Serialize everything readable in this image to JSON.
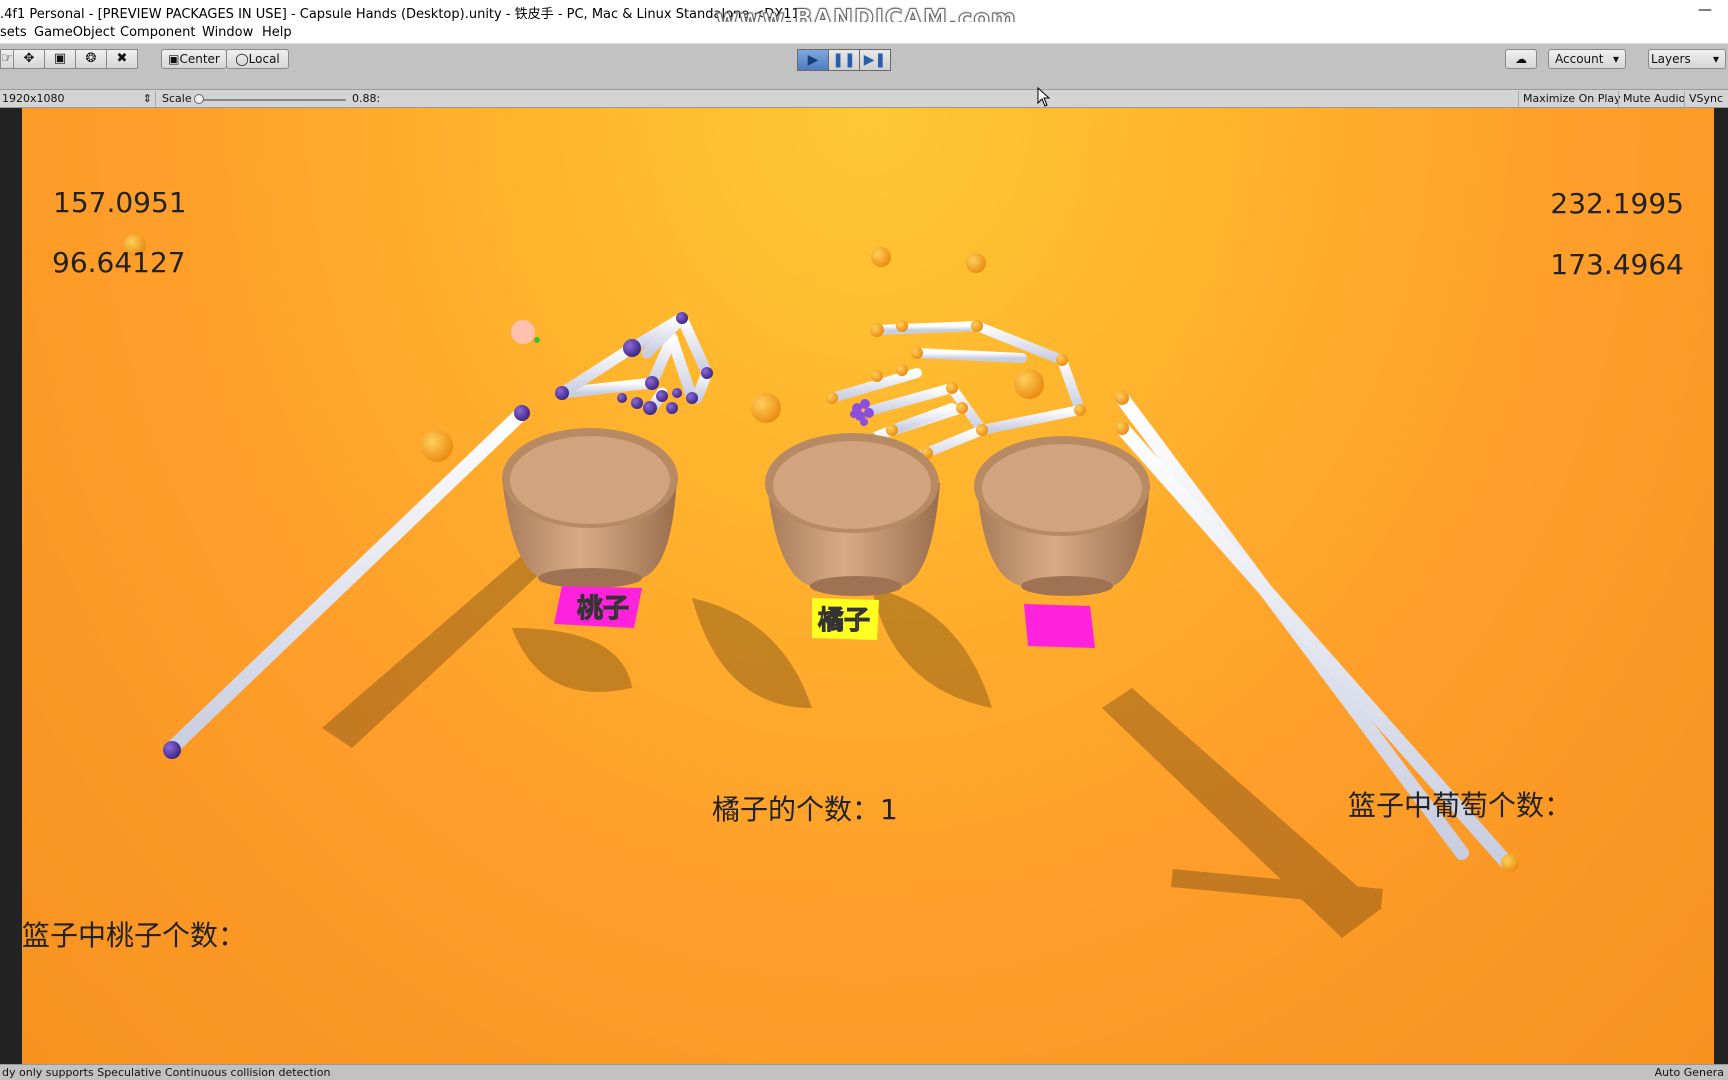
{
  "window": {
    "title": ".4f1 Personal - [PREVIEW PACKAGES IN USE] - Capsule Hands (Desktop).unity - 铁皮手 - PC, Mac & Linux Standalone <DX11>",
    "watermark": "www.BANDICAM.com",
    "minimize_glyph": "—"
  },
  "menu": {
    "items": [
      "sets",
      "GameObject",
      "Component",
      "Window",
      "Help"
    ]
  },
  "toolbar": {
    "tools": [
      "hand-tool-icon",
      "move-tool-icon",
      "rect-tool-icon",
      "transform-tool-icon",
      "custom-tool-icon"
    ],
    "pivot_label": "Center",
    "space_label": "Local",
    "account_label": "Account",
    "layers_label": "Layers",
    "play_active_color": "#4e7dc0"
  },
  "gamebar": {
    "resolution": "1920x1080",
    "scale_label": "Scale",
    "scale_value": "0.88:",
    "maximize_label": "Maximize On Play",
    "mute_label": "Mute Audio",
    "vsync_label": "VSync"
  },
  "hud": {
    "top_left_1": "157.0951",
    "top_left_2": "96.64127",
    "top_right_1": "232.1995",
    "top_right_2": "173.4964",
    "orange_count": "橘子的个数：1",
    "grape_basket_count": "篮子中葡萄个数：",
    "peach_basket_count": "篮子中桃子个数："
  },
  "scene": {
    "labels": [
      "桃子",
      "橘子",
      ""
    ],
    "label_colors": [
      "#ff22dd",
      "#ffff22",
      "#ff22dd"
    ],
    "background_color": "#ff9e2a",
    "basket_color": "#c99a72"
  },
  "status": {
    "message": "dy only supports Speculative Continuous collision detection",
    "right_text": "Auto Genera"
  }
}
